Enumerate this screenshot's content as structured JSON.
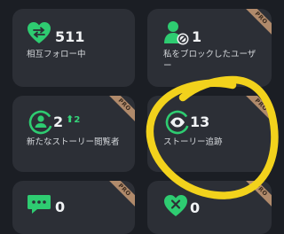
{
  "cards": [
    {
      "value": "511",
      "label": "相互フォロー中",
      "pro": ""
    },
    {
      "value": "1",
      "label": "私をブロックしたユーザー",
      "pro": "PRO"
    },
    {
      "value": "2",
      "delta": "2",
      "label": "新たなストーリー閲覧者",
      "pro": "PRO"
    },
    {
      "value": "13",
      "label": "ストーリー追跡",
      "pro": "PRO"
    },
    {
      "value": "0",
      "label": "",
      "pro": "PRO"
    },
    {
      "value": "0",
      "label": "",
      "pro": "PRO"
    }
  ],
  "colors": {
    "accent": "#2ecc71",
    "card": "#2c2f36",
    "background": "#1b1e24",
    "highlight": "#f2d21c",
    "pro_badge": "#b08a6b"
  },
  "icons": [
    "heart-arrows-icon",
    "user-blocked-icon",
    "story-viewer-icon",
    "eye-tracking-icon",
    "chat-bubble-icon",
    "heart-x-icon"
  ]
}
